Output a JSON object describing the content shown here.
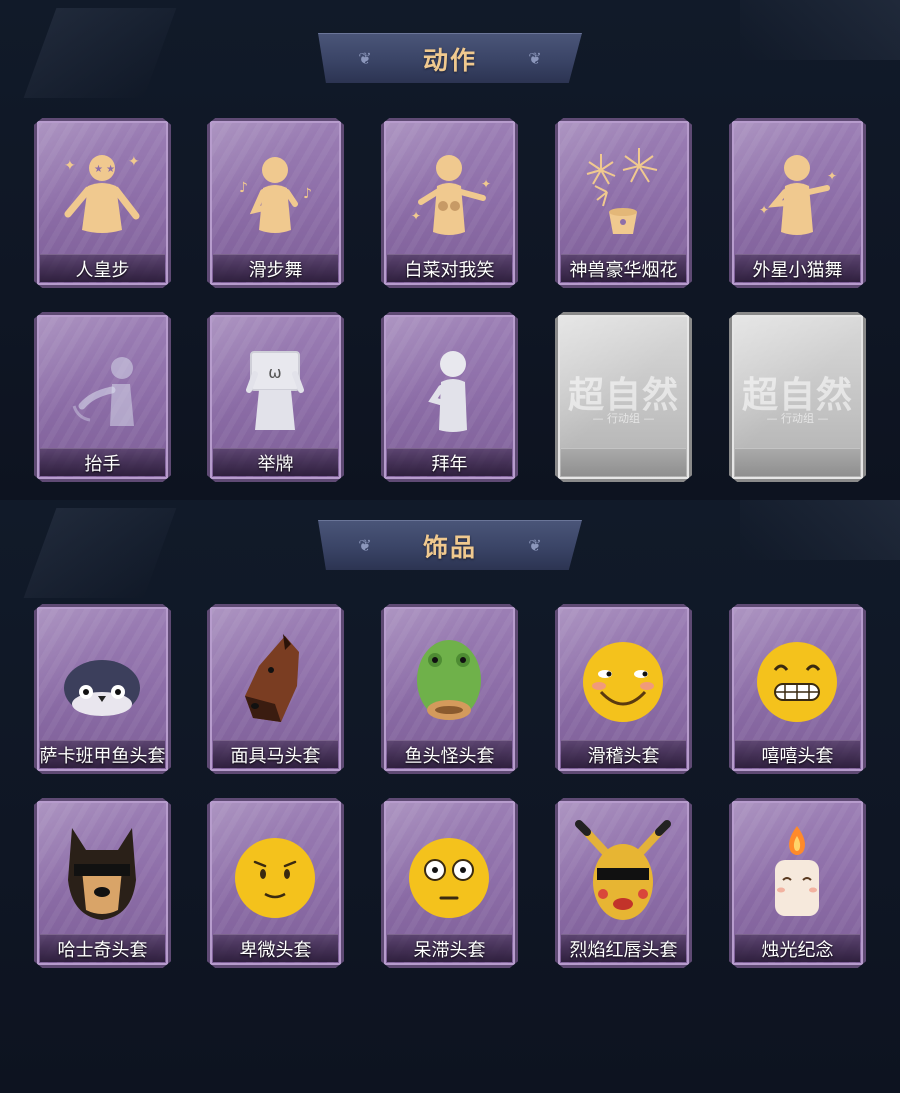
{
  "sections": [
    {
      "title": "动作",
      "items": [
        {
          "label": "人皇步",
          "icon": "dancing-figure-icon"
        },
        {
          "label": "滑步舞",
          "icon": "moonwalk-figure-icon"
        },
        {
          "label": "白菜对我笑",
          "icon": "cabbage-smile-figure-icon"
        },
        {
          "label": "神兽豪华烟花",
          "icon": "fireworks-icon"
        },
        {
          "label": "外星小猫舞",
          "icon": "alien-cat-dance-figure-icon"
        },
        {
          "label": "抬手",
          "icon": "raise-hand-figure-icon"
        },
        {
          "label": "举牌",
          "icon": "hold-sign-figure-icon"
        },
        {
          "label": "拜年",
          "icon": "new-year-greeting-figure-icon"
        },
        {
          "label": "",
          "icon": "locked-placeholder-icon",
          "locked": true,
          "stamp": "超自然",
          "stamp_sub": "— 行动组 —"
        },
        {
          "label": "",
          "icon": "locked-placeholder-icon",
          "locked": true,
          "stamp": "超自然",
          "stamp_sub": "— 行动组 —"
        }
      ]
    },
    {
      "title": "饰品",
      "items": [
        {
          "label": "萨卡班甲鱼头套",
          "icon": "sacabambaspis-head-icon"
        },
        {
          "label": "面具马头套",
          "icon": "horse-mask-icon"
        },
        {
          "label": "鱼头怪头套",
          "icon": "fish-head-icon"
        },
        {
          "label": "滑稽头套",
          "icon": "funny-face-icon"
        },
        {
          "label": "嘻嘻头套",
          "icon": "grin-face-icon"
        },
        {
          "label": "哈士奇头套",
          "icon": "husky-sunglasses-icon"
        },
        {
          "label": "卑微头套",
          "icon": "humble-face-icon"
        },
        {
          "label": "呆滞头套",
          "icon": "dazed-face-icon"
        },
        {
          "label": "烈焰红唇头套",
          "icon": "pikachu-sunglasses-icon"
        },
        {
          "label": "烛光纪念",
          "icon": "candle-icon"
        }
      ]
    }
  ],
  "colors": {
    "card_purple": "#8e6fa9",
    "card_locked": "#c4c4c4",
    "banner": "#3a4466",
    "title_gold": "#f0c98f",
    "background": "#0d1320"
  }
}
